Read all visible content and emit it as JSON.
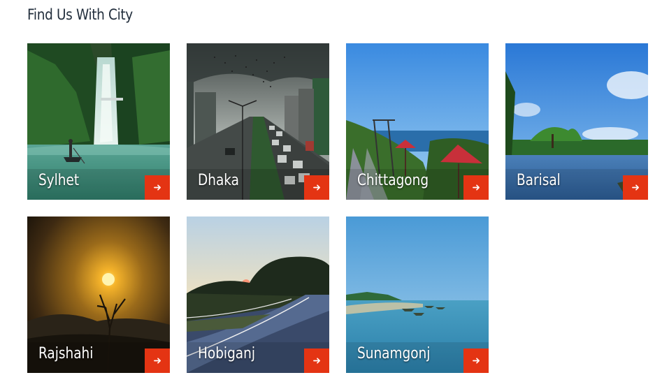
{
  "section": {
    "title": "Find Us With City"
  },
  "colors": {
    "heading": "#222e3c",
    "button": "#e43413",
    "label": "#ffffff"
  },
  "cities": [
    {
      "name": "Sylhet",
      "button_icon": "arrow-right-icon"
    },
    {
      "name": "Dhaka",
      "button_icon": "arrow-right-icon"
    },
    {
      "name": "Chittagong",
      "button_icon": "arrow-right-icon"
    },
    {
      "name": "Barisal",
      "button_icon": "arrow-right-icon"
    },
    {
      "name": "Rajshahi",
      "button_icon": "arrow-right-icon"
    },
    {
      "name": "Hobiganj",
      "button_icon": "arrow-right-icon"
    },
    {
      "name": "Sunamgonj",
      "button_icon": "arrow-right-icon"
    }
  ]
}
